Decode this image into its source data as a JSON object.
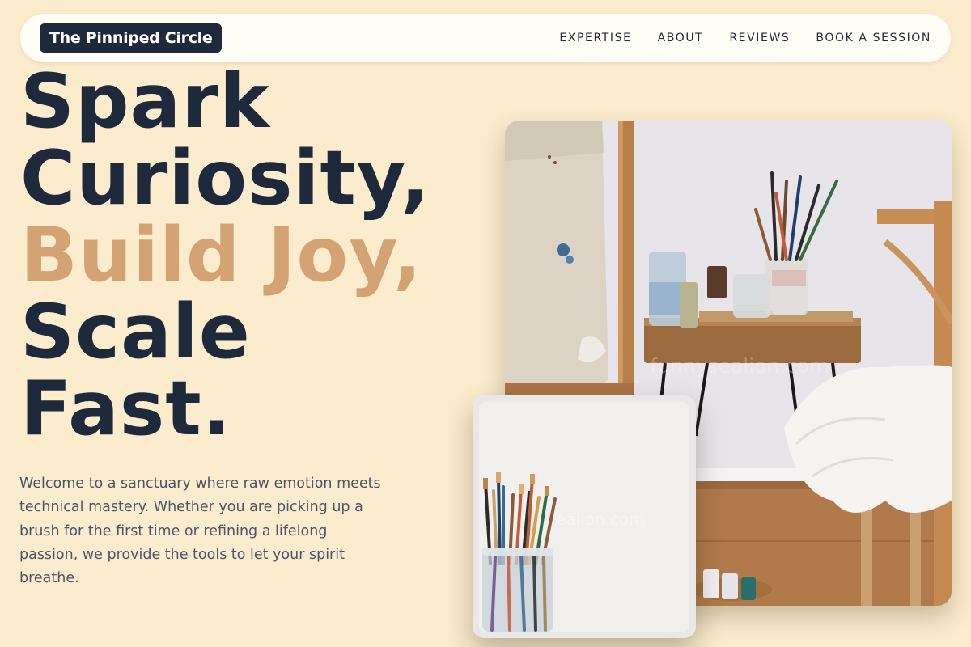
{
  "nav": {
    "brand": "The Pinniped Circle",
    "links": [
      "EXPERTISE",
      "ABOUT",
      "REVIEWS",
      "BOOK A SESSION"
    ]
  },
  "hero": {
    "lines": [
      "Spark",
      "Curiosity,",
      "Build Joy,",
      "Scale",
      "Fast."
    ],
    "intro": "Welcome to a sanctuary where raw emotion meets technical mastery. Whether you are picking up a brush for the first time or refining a lifelong passion, we provide the tools to let your spirit breathe."
  },
  "images": {
    "main_watermark": "funnysealion.com",
    "small_watermark": "ealion.com"
  },
  "colors": {
    "background": "#fbecce",
    "navy": "#1e293b",
    "accent": "#d4a373",
    "body_text": "#4a5568",
    "nav_bg": "#fffdf6"
  }
}
